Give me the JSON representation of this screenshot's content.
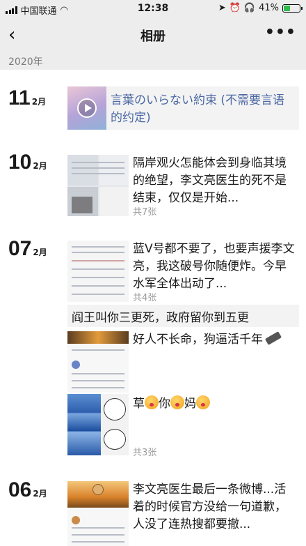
{
  "status": {
    "carrier": "中国联通",
    "time": "12:38",
    "battery": "41%",
    "battery_level": 0.41
  },
  "nav": {
    "title": "相册",
    "back_glyph": "‹",
    "more_glyph": "•••"
  },
  "year": "2020年",
  "entries": [
    {
      "day": "11",
      "month": "2月",
      "video_title": "言葉のいらない約束 (不需要言语的约定)"
    },
    {
      "day": "10",
      "month": "2月",
      "text": "隔岸观火怎能体会到身临其境的绝望，李文亮医生的死不是结束，仅仅是开始...",
      "count": "共7张"
    },
    {
      "day": "07",
      "month": "2月",
      "text": "蓝V号都不要了，也要声援李文亮，我这破号你随便炸。今早水军全体出动了...",
      "count": "共4张",
      "quote": "阎王叫你三更死，政府留你到五更",
      "text2": "好人不长命，狗逼活千年",
      "text3_parts": [
        "草",
        "你",
        "妈"
      ],
      "count2": "共3张"
    },
    {
      "day": "06",
      "month": "2月",
      "text": "李文亮医生最后一条微博...活着的时候官方没给一句道歉，人没了连热搜都要撤..."
    }
  ],
  "icons": {
    "back": "back-chevron-icon",
    "more": "more-dots-icon",
    "play": "play-icon",
    "emoji": "kiss-emoji-icon",
    "pencil": "pencil-icon"
  }
}
